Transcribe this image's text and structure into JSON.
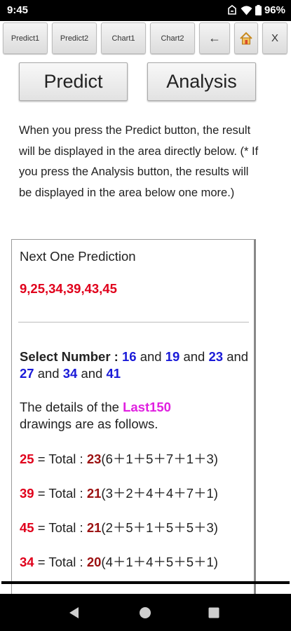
{
  "status_bar": {
    "time": "9:45",
    "battery": "96%",
    "icons": [
      "rotate-icon",
      "wifi-icon",
      "battery-icon"
    ]
  },
  "toolbar": {
    "predict1": "Predict1",
    "predict2": "Predict2",
    "chart1": "Chart1",
    "chart2": "Chart2",
    "back_icon": "←",
    "home_icon": "🏠",
    "close": "X"
  },
  "main_buttons": {
    "predict": "Predict",
    "analysis": "Analysis"
  },
  "intro_text": "When you press the Predict button, the result will be displayed in the area directly below. (* If you press the Analysis button, the results will be displayed in the area below one more.)",
  "result": {
    "title": "Next One Prediction",
    "numbers": "9,25,34,39,43,45",
    "select_label": "Select Number :",
    "select_numbers": [
      "16",
      "19",
      "23",
      "27",
      "34",
      "41"
    ],
    "and_word": "and",
    "details_prefix": "The details of the",
    "details_highlight": "Last150",
    "details_suffix": "drawings are as follows.",
    "stats": [
      {
        "number": "25",
        "label": "= Total :",
        "total": "23",
        "breakdown": "(6＋1＋5＋7＋1＋3)"
      },
      {
        "number": "39",
        "label": "= Total :",
        "total": "21",
        "breakdown": "(3＋2＋4＋4＋7＋1)"
      },
      {
        "number": "45",
        "label": "= Total :",
        "total": "21",
        "breakdown": "(2＋5＋1＋5＋5＋3)"
      },
      {
        "number": "34",
        "label": "= Total :",
        "total": "20",
        "breakdown": "(4＋1＋4＋5＋5＋1)"
      }
    ]
  },
  "colors": {
    "prediction_red": "#e0001b",
    "select_blue": "#1a1ad8",
    "highlight_magenta": "#e020e0",
    "total_maroon": "#9b1111"
  }
}
